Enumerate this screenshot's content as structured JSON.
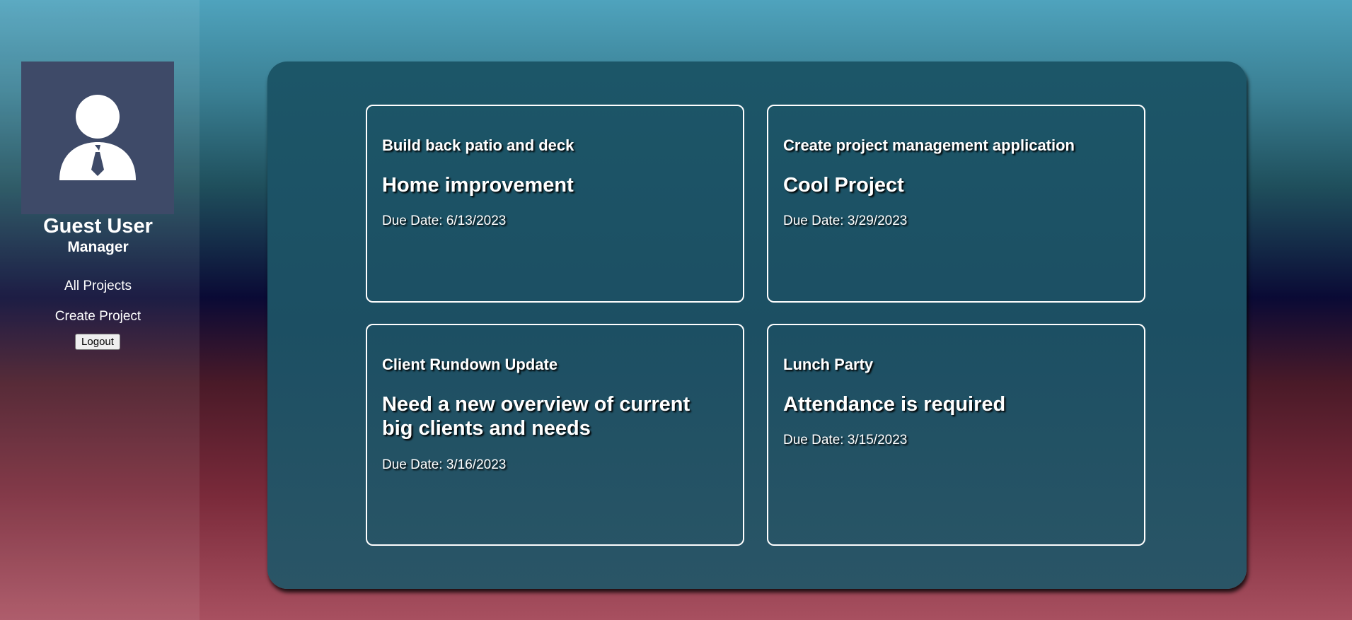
{
  "sidebar": {
    "avatar_icon": "user-with-tie-icon",
    "user_name": "Guest User",
    "user_role": "Manager",
    "nav": {
      "all_projects": "All Projects",
      "create_project": "Create Project"
    },
    "logout_label": "Logout"
  },
  "projects": [
    {
      "title": "Build back patio and deck",
      "description": "Home improvement",
      "due": "Due Date: 6/13/2023"
    },
    {
      "title": "Create project management application",
      "description": "Cool Project",
      "due": "Due Date: 3/29/2023"
    },
    {
      "title": "Client Rundown Update",
      "description": "Need a new overview of current big clients and needs",
      "due": "Due Date: 3/16/2023"
    },
    {
      "title": "Lunch Party",
      "description": "Attendance is required",
      "due": "Due Date: 3/15/2023"
    }
  ],
  "colors": {
    "avatar_bg": "#3e4a68",
    "panel_bg": "#1c5668",
    "card_border": "#ffffff",
    "text": "#ffffff"
  }
}
